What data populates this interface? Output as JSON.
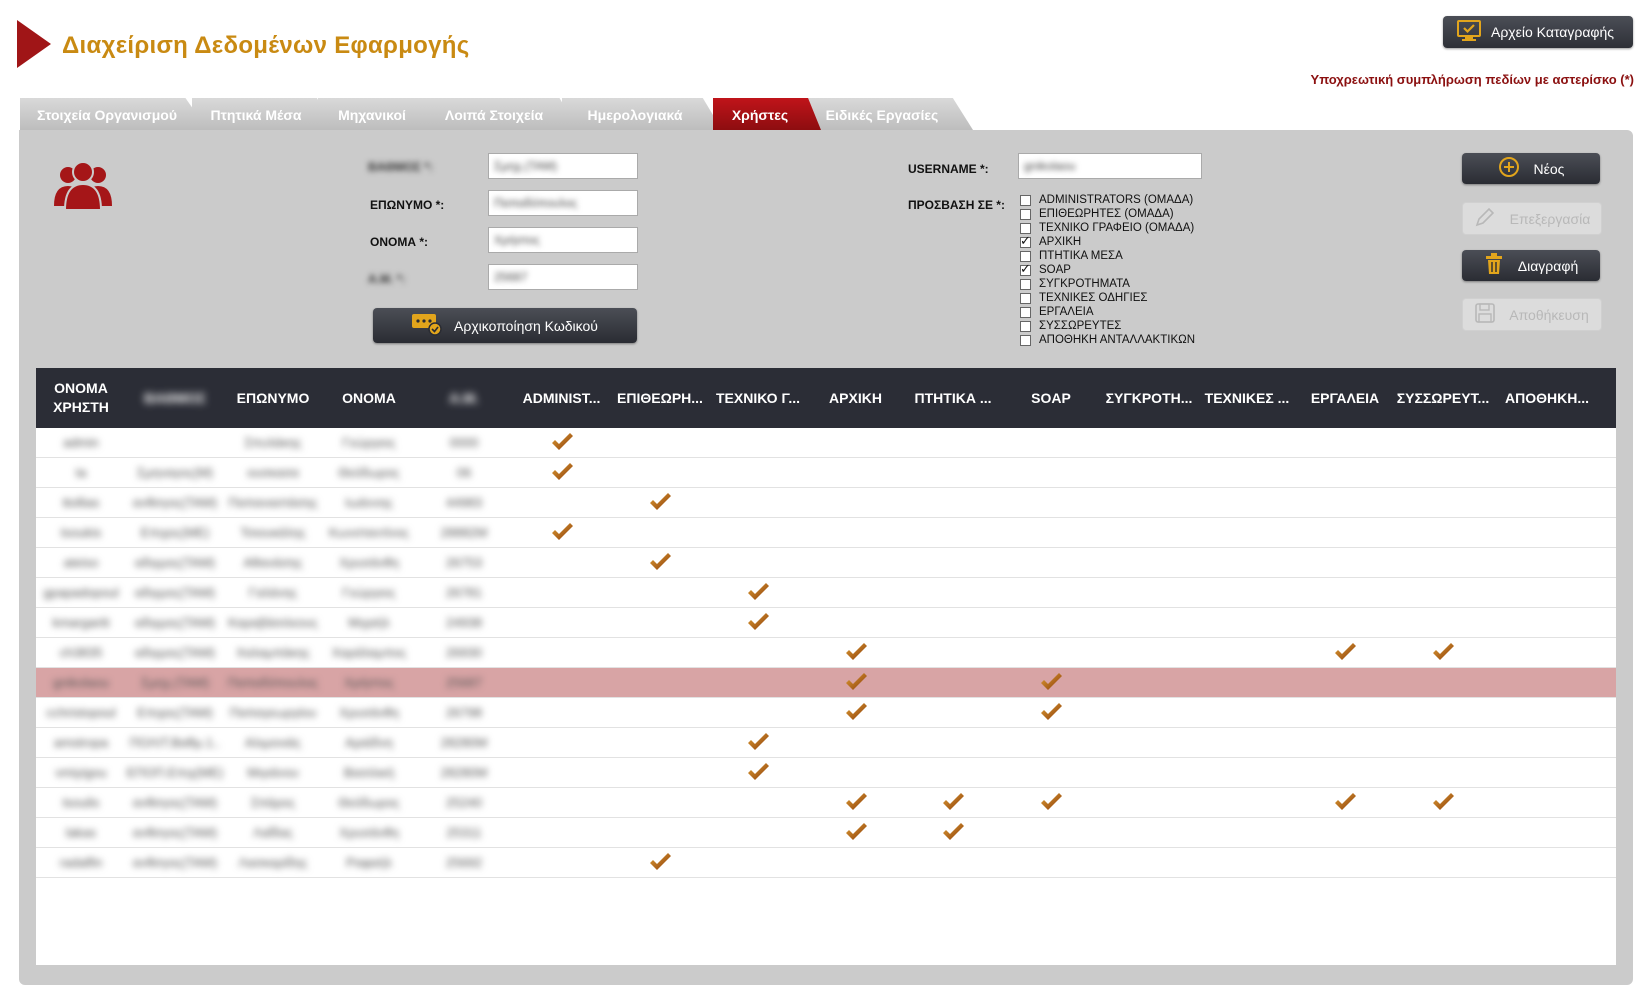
{
  "header": {
    "title": "Διαχείριση Δεδομένων Εφαρμογής",
    "log_button_label": "Αρχείο Καταγραφής",
    "required_note": "Υποχρεωτική συμπλήρωση πεδίων με αστερίσκο (*)"
  },
  "tabs": [
    {
      "label": "Στοιχεία Οργανισμού",
      "active": false
    },
    {
      "label": "Πτητικά Μέσα",
      "active": false
    },
    {
      "label": "Μηχανικοί",
      "active": false
    },
    {
      "label": "Λοιπά Στοιχεία",
      "active": false
    },
    {
      "label": "Ημερολογιακά",
      "active": false
    },
    {
      "label": "Χρήστες",
      "active": true
    },
    {
      "label": "Ειδικές Εργασίες",
      "active": false
    }
  ],
  "form": {
    "field1_label": "ΒΑΘΜΟΣ *:",
    "field1_value": "Σμηχ.(ΤΑΜ)",
    "surname_label": "ΕΠΩΝΥΜΟ *:",
    "surname_value": "Παπαδόπουλος",
    "name_label": "ΟΝΟΜΑ *:",
    "name_value": "Χρήστος",
    "am_label": "Α.Μ. *:",
    "am_value": "25687",
    "reset_button_label": "Αρχικοποίηση Κωδικού",
    "username_label": "USERNAME *:",
    "username_value": "gnikolaou",
    "access_label": "ΠΡΟΣΒΑΣΗ ΣΕ *:",
    "access_options": [
      {
        "label": "ADMINISTRATORS (ΟΜΑΔΑ)",
        "checked": false
      },
      {
        "label": "ΕΠΙΘΕΩΡΗΤΕΣ (ΟΜΑΔΑ)",
        "checked": false
      },
      {
        "label": "ΤΕΧΝΙΚΟ ΓΡΑΦΕΙΟ (ΟΜΑΔΑ)",
        "checked": false
      },
      {
        "label": "ΑΡΧΙΚΗ",
        "checked": true
      },
      {
        "label": "ΠΤΗΤΙΚΑ ΜΕΣΑ",
        "checked": false
      },
      {
        "label": "SOAP",
        "checked": true
      },
      {
        "label": "ΣΥΓΚΡΟΤΗΜΑΤΑ",
        "checked": false
      },
      {
        "label": "ΤΕΧΝΙΚΕΣ ΟΔΗΓΙΕΣ",
        "checked": false
      },
      {
        "label": "ΕΡΓΑΛΕΙΑ",
        "checked": false
      },
      {
        "label": "ΣΥΣΣΩΡΕΥΤΕΣ",
        "checked": false
      },
      {
        "label": "ΑΠΟΘΗΚΗ ΑΝΤΑΛΛΑΚΤΙΚΩΝ",
        "checked": false
      }
    ]
  },
  "actions": {
    "new_label": "Νέος",
    "edit_label": "Επεξεργασία",
    "delete_label": "Διαγραφή",
    "save_label": "Αποθήκευση"
  },
  "grid": {
    "columns": [
      "ΟΝΟΜΑ ΧΡΗΣΤΗ",
      "ΒΑΘΜΟΣ",
      "ΕΠΩΝΥΜΟ",
      "ΟΝΟΜΑ",
      "Α.Μ.",
      "ADMINIST...",
      "ΕΠΙΘΕΩΡΗ...",
      "ΤΕΧΝΙΚΟ Γ...",
      "ΑΡΧΙΚΗ",
      "ΠΤΗΤΙΚΑ ...",
      "SOAP",
      "ΣΥΓΚΡΟΤΗ...",
      "ΤΕΧΝΙΚΕΣ ...",
      "ΕΡΓΑΛΕΙΑ",
      "ΣΥΣΣΩΡΕΥΤ...",
      "ΑΠΟΘΗΚΗ..."
    ],
    "rows": [
      {
        "cells": [
          "admin",
          "",
          "Σπυλάκης",
          "Γεώργιος",
          "0000"
        ],
        "checks": [
          1,
          0,
          0,
          0,
          0,
          0,
          0,
          0,
          0,
          0,
          0
        ],
        "selected": false
      },
      {
        "cells": [
          "ta",
          "Σμηναγος(Μ)",
          "ουσκασα",
          "Θεόδωρος",
          "06"
        ],
        "checks": [
          1,
          0,
          0,
          0,
          0,
          0,
          0,
          0,
          0,
          0,
          0
        ],
        "selected": false
      },
      {
        "cells": [
          "ttollias",
          "ανθσγος(ΤΑΜ)",
          "Παπαναστάσης",
          "Ιωάννης",
          "44983"
        ],
        "checks": [
          0,
          1,
          0,
          0,
          0,
          0,
          0,
          0,
          0,
          0,
          0
        ],
        "selected": false
      },
      {
        "cells": [
          "tsoukis",
          "Επιχος(ΜΕ)",
          "Τσιουκάλης",
          "Κωνσταντίνος",
          "28882Μ"
        ],
        "checks": [
          1,
          0,
          0,
          0,
          0,
          0,
          0,
          0,
          0,
          0,
          0
        ],
        "selected": false
      },
      {
        "cells": [
          "ateiso",
          "αδιγμος(ΤΑΜ)",
          "Αθανάσης",
          "Χρυσάνθη",
          "26753"
        ],
        "checks": [
          0,
          1,
          0,
          0,
          0,
          0,
          0,
          0,
          0,
          0,
          0
        ],
        "selected": false
      },
      {
        "cells": [
          "gpapadopoul",
          "αδιγμος(ΤΑΜ)",
          "Γαλάνης",
          "Γεώργιος",
          "26781"
        ],
        "checks": [
          0,
          0,
          1,
          0,
          0,
          0,
          0,
          0,
          0,
          0,
          0
        ],
        "selected": false
      },
      {
        "cells": [
          "kmargariti",
          "αδιγμος(ΤΑΜ)",
          "Καραβάσιλεους",
          "Μιχαήλ",
          "24938"
        ],
        "checks": [
          0,
          0,
          1,
          0,
          0,
          0,
          0,
          0,
          0,
          0,
          0
        ],
        "selected": false
      },
      {
        "cells": [
          "ch3835",
          "αδιγμος(ΤΑΜ)",
          "Χαλαμπάκης",
          "Χαράλαμπος",
          "26930"
        ],
        "checks": [
          0,
          0,
          0,
          1,
          0,
          0,
          0,
          0,
          1,
          1,
          0
        ],
        "selected": false
      },
      {
        "cells": [
          "gnikolaou",
          "Σμηχ.(ΤΑΜ)",
          "Παπαδόπουλος",
          "Χρήστος",
          "25687"
        ],
        "checks": [
          0,
          0,
          0,
          1,
          0,
          1,
          0,
          0,
          0,
          0,
          0
        ],
        "selected": true
      },
      {
        "cells": [
          "cchristopoul",
          "Επιχος(ΤΑΜ)",
          "Παπαγεωργίου",
          "Χρυσάνθη",
          "26798"
        ],
        "checks": [
          0,
          0,
          0,
          1,
          0,
          1,
          0,
          0,
          0,
          0,
          0
        ],
        "selected": false
      },
      {
        "cells": [
          "amstropa",
          "ΠΟΛΙΤ.Βαθμ.1..",
          "Αλιμονιάς",
          "Αριάδνη",
          "28280Μ"
        ],
        "checks": [
          0,
          0,
          1,
          0,
          0,
          0,
          0,
          0,
          0,
          0,
          0
        ],
        "selected": false
      },
      {
        "cells": [
          "vmiyigou",
          "ΕΠΟΠ.Επιχ(ΜΕ)",
          "Μιγιάνου",
          "Βασιλική",
          "28280Μ"
        ],
        "checks": [
          0,
          0,
          1,
          0,
          0,
          0,
          0,
          0,
          0,
          0,
          0
        ],
        "selected": false
      },
      {
        "cells": [
          "tsoulis",
          "ανθσγος(ΤΑΜ)",
          "Σπάρος",
          "Θεόδωρος",
          "25240"
        ],
        "checks": [
          0,
          0,
          0,
          1,
          1,
          1,
          0,
          0,
          1,
          1,
          0
        ],
        "selected": false
      },
      {
        "cells": [
          "lakas",
          "ανθσγος(ΤΑΜ)",
          "Λαΐδας",
          "Χρυσάνθη",
          "25311"
        ],
        "checks": [
          0,
          0,
          0,
          1,
          1,
          0,
          0,
          0,
          0,
          0,
          0
        ],
        "selected": false
      },
      {
        "cells": [
          "radalfin",
          "ανθσγος(ΤΑΜ)",
          "Λασκαρίδης",
          "Ραφαήλ",
          "25692"
        ],
        "checks": [
          0,
          1,
          0,
          0,
          0,
          0,
          0,
          0,
          0,
          0,
          0
        ],
        "selected": false
      }
    ]
  },
  "colors": {
    "accent": "#a01517",
    "title": "#c98a12",
    "check": "#b8650e",
    "selected_row": "#d8a4a5"
  }
}
